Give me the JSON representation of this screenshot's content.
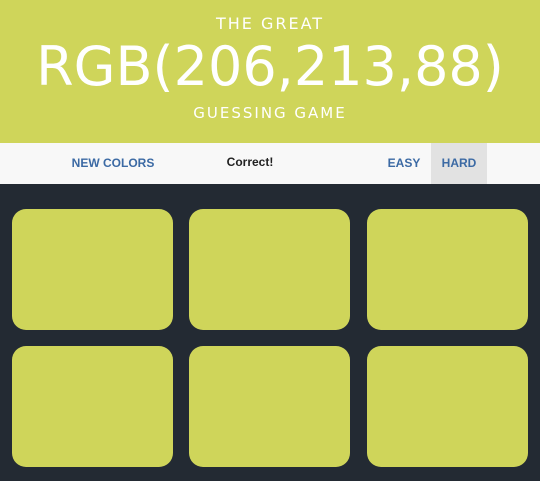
{
  "header": {
    "line1": "THE GREAT",
    "rgb_display": "RGB(206,213,88)",
    "line3": "GUESSING GAME",
    "background_color": "#cfd55a"
  },
  "controls": {
    "new_colors_label": "NEW COLORS",
    "message": "Correct!",
    "easy_label": "EASY",
    "hard_label": "HARD",
    "selected_mode": "HARD"
  },
  "squares": [
    {
      "color": "#cfd55a"
    },
    {
      "color": "#cfd55a"
    },
    {
      "color": "#cfd55a"
    },
    {
      "color": "#cfd55a"
    },
    {
      "color": "#cfd55a"
    },
    {
      "color": "#cfd55a"
    }
  ],
  "colors": {
    "page_background": "#232a33",
    "stripe_background": "#f8f8f8",
    "button_text": "#3c6aa4",
    "selected_button_background": "#e2e2e2"
  }
}
